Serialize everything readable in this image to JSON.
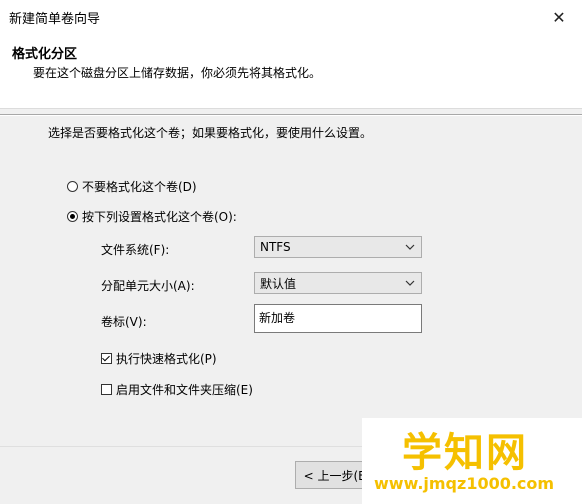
{
  "window": {
    "title": "新建简单卷向导",
    "close_glyph": "✕"
  },
  "header": {
    "title": "格式化分区",
    "subtitle": "要在这个磁盘分区上储存数据，你必须先将其格式化。"
  },
  "question": "选择是否要格式化这个卷；如果要格式化，要使用什么设置。",
  "options": {
    "no_format": {
      "label": "不要格式化这个卷(D)",
      "checked": false
    },
    "format": {
      "label": "按下列设置格式化这个卷(O):",
      "checked": true
    }
  },
  "fields": {
    "filesystem": {
      "label": "文件系统(F):",
      "value": "NTFS"
    },
    "alloc_size": {
      "label": "分配单元大小(A):",
      "value": "默认值"
    },
    "volume_label": {
      "label": "卷标(V):",
      "value": "新加卷"
    }
  },
  "checks": {
    "quick_format": {
      "label": "执行快速格式化(P)",
      "checked": true
    },
    "compression": {
      "label": "启用文件和文件夹压缩(E)",
      "checked": false
    }
  },
  "buttons": {
    "prev": "< 上一步(B"
  },
  "watermark": {
    "main": "学知网",
    "url": "www.jmqz1000.com"
  },
  "colors": {
    "watermark": "#f5c000",
    "dialog_bg": "#f0f0f0"
  }
}
